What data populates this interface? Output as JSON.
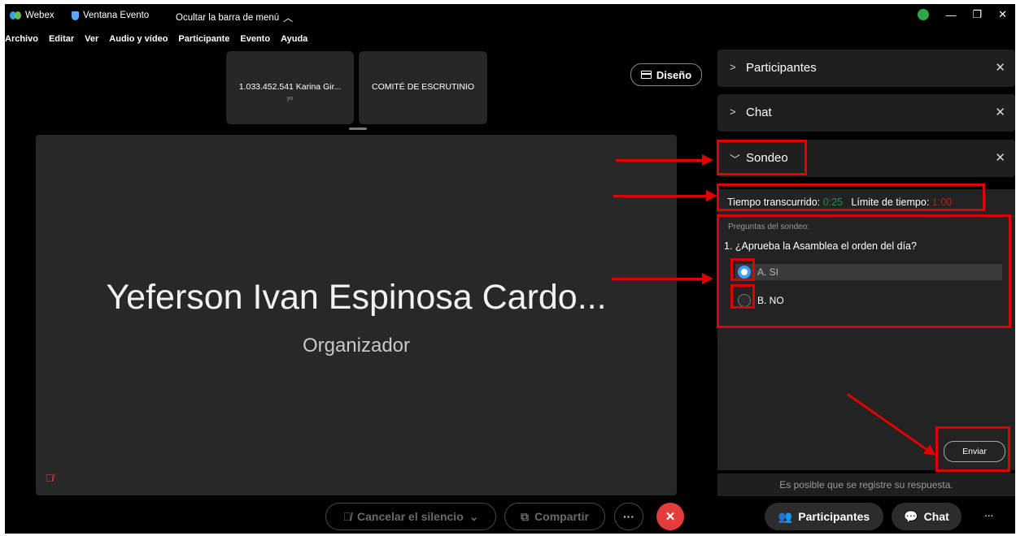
{
  "titlebar": {
    "app_name": "Webex",
    "window_name": "Ventana Evento",
    "hide_menu": "Ocultar la barra de menú"
  },
  "menu": [
    "Archivo",
    "Editar",
    "Ver",
    "Audio y vídeo",
    "Participante",
    "Evento",
    "Ayuda"
  ],
  "thumbnails": [
    {
      "name": "1.033.452.541 Karina Gir...",
      "sub": "yo"
    },
    {
      "name": "COMITÉ DE ESCRUTINIO"
    }
  ],
  "layout_button": "Diseño",
  "stage": {
    "name": "Yeferson Ivan Espinosa Cardo...",
    "role": "Organizador"
  },
  "panels": {
    "participants": "Participantes",
    "chat": "Chat",
    "poll": "Sondeo"
  },
  "poll": {
    "elapsed_label": "Tiempo transcurrido:",
    "elapsed_value": "0:25",
    "limit_label": "Límite de tiempo:",
    "limit_value": "1:00",
    "questions_header": "Preguntas del sondeo:",
    "question": "1.  ¿Aprueba la Asamblea el orden del día?",
    "options": [
      {
        "label": "A.  SI",
        "selected": true
      },
      {
        "label": "B.  NO",
        "selected": false
      }
    ],
    "submit": "Enviar",
    "note": "Es posible que se registre su respuesta."
  },
  "controls": {
    "unmute": "Cancelar el silencio",
    "share": "Compartir",
    "more": "···",
    "end": "✕",
    "participants": "Participantes",
    "chat": "Chat",
    "overflow": "···"
  },
  "colors": {
    "accent_red": "#e00000",
    "end_button": "#e23c3c",
    "selected_radio": "#3fa0ff",
    "elapsed_green": "#2d8a46",
    "limit_red": "#b51f1f"
  }
}
